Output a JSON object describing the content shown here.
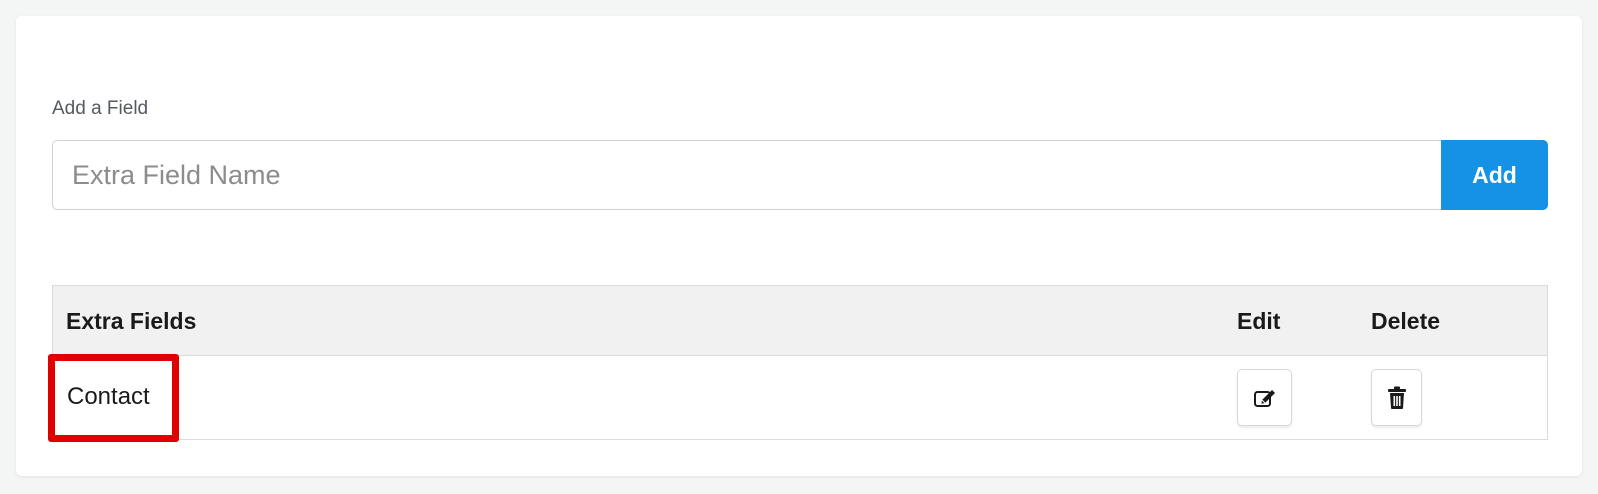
{
  "form": {
    "label": "Add a Field",
    "placeholder": "Extra Field Name",
    "value": "",
    "add_label": "Add"
  },
  "table": {
    "headers": {
      "name": "Extra Fields",
      "edit": "Edit",
      "delete": "Delete"
    },
    "rows": [
      {
        "name": "Contact"
      }
    ]
  },
  "icons": {
    "edit": "edit-pencil-square-icon",
    "delete": "trash-icon"
  },
  "colors": {
    "accent": "#1592e6",
    "highlight": "#e00000",
    "header_bg": "#f1f1f1"
  }
}
